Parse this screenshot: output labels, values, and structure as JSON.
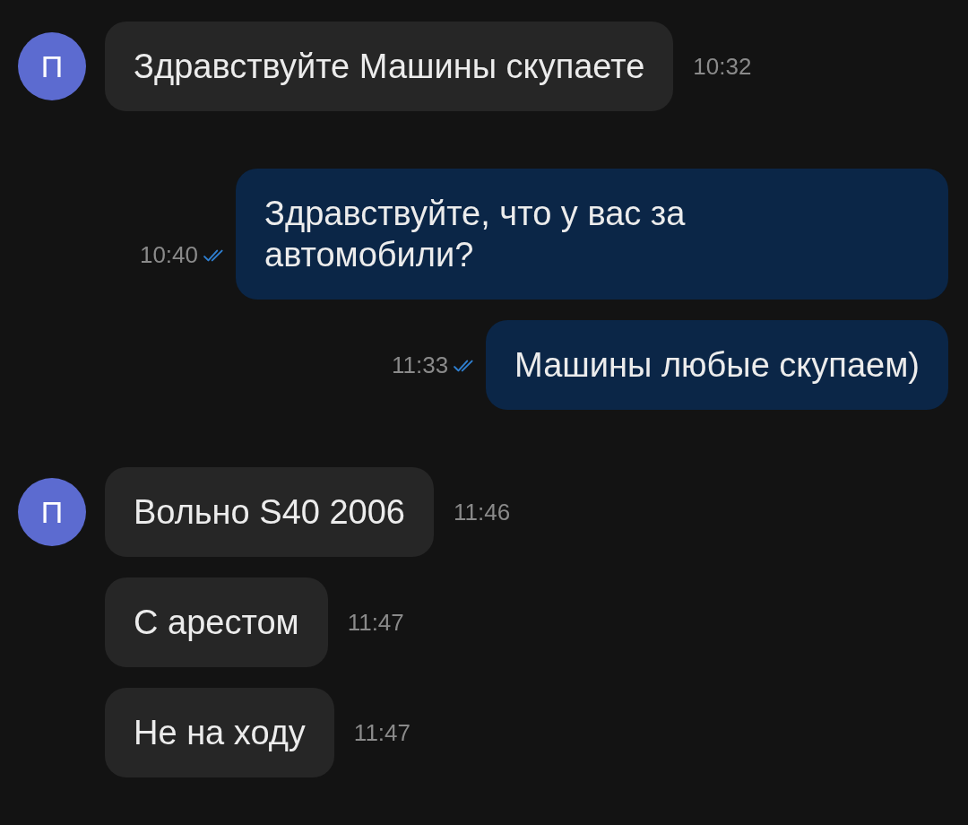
{
  "groups": [
    {
      "kind": "incoming",
      "avatar": "П",
      "messages": [
        {
          "text": "Здравствуйте Машины скупаете",
          "time": "10:32"
        }
      ]
    },
    {
      "kind": "outgoing",
      "messages": [
        {
          "text": "Здравствуйте, что у вас за автомобили?",
          "time": "10:40",
          "read": true
        },
        {
          "text": "Машины любые скупаем)",
          "time": "11:33",
          "read": true
        }
      ]
    },
    {
      "kind": "incoming",
      "avatar": "П",
      "messages": [
        {
          "text": "Вольно S40 2006",
          "time": "11:46"
        },
        {
          "text": "С арестом",
          "time": "11:47"
        },
        {
          "text": "Не на ходу",
          "time": "11:47"
        }
      ]
    }
  ]
}
